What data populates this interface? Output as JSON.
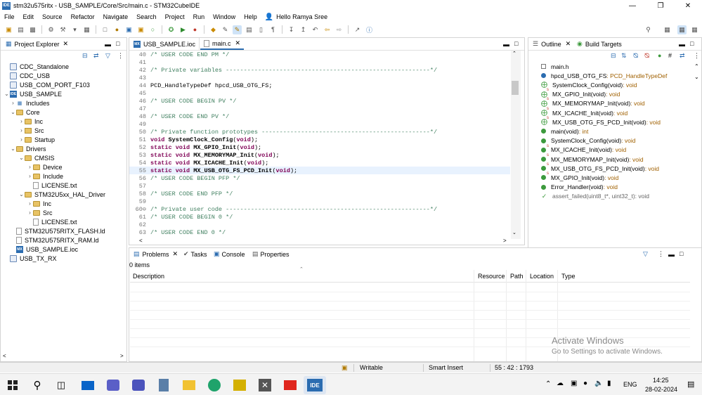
{
  "window": {
    "title": "stm32u575ritx - USB_SAMPLE/Core/Src/main.c - STM32CubeIDE",
    "app_icon": "IDE",
    "controls": [
      "minimize",
      "maximize",
      "close"
    ]
  },
  "menubar": {
    "items": [
      "File",
      "Edit",
      "Source",
      "Refactor",
      "Navigate",
      "Search",
      "Project",
      "Run",
      "Window",
      "Help"
    ],
    "user": "Hello Ramya Sree"
  },
  "project_explorer": {
    "title": "Project Explorer",
    "items": [
      {
        "label": "CDC_Standalone",
        "icon": "project-icon"
      },
      {
        "label": "CDC_USB",
        "icon": "project-icon"
      },
      {
        "label": "USB_COM_PORT_F103",
        "icon": "project-icon"
      },
      {
        "label": "USB_SAMPLE",
        "icon": "ide-project-icon"
      },
      {
        "label": "Includes",
        "icon": "includes-icon"
      },
      {
        "label": "Core",
        "icon": "folder-icon"
      },
      {
        "label": "Inc",
        "icon": "folder-icon"
      },
      {
        "label": "Src",
        "icon": "source-folder-icon"
      },
      {
        "label": "Startup",
        "icon": "folder-icon"
      },
      {
        "label": "Drivers",
        "icon": "folder-icon"
      },
      {
        "label": "CMSIS",
        "icon": "folder-icon"
      },
      {
        "label": "Device",
        "icon": "folder-icon"
      },
      {
        "label": "Include",
        "icon": "folder-icon"
      },
      {
        "label": "LICENSE.txt",
        "icon": "file-icon"
      },
      {
        "label": "STM32U5xx_HAL_Driver",
        "icon": "folder-icon"
      },
      {
        "label": "Inc",
        "icon": "folder-icon"
      },
      {
        "label": "Src",
        "icon": "folder-icon"
      },
      {
        "label": "LICENSE.txt",
        "icon": "file-icon"
      },
      {
        "label": "STM32U575RITX_FLASH.ld",
        "icon": "linker-file-icon"
      },
      {
        "label": "STM32U575RITX_RAM.ld",
        "icon": "linker-file-icon"
      },
      {
        "label": "USB_SAMPLE.ioc",
        "icon": "ioc-file-icon"
      },
      {
        "label": "USB_TX_RX",
        "icon": "project-icon"
      }
    ]
  },
  "editor": {
    "tabs": [
      {
        "label": "USB_SAMPLE.ioc",
        "active": false
      },
      {
        "label": "main.c",
        "active": true
      }
    ],
    "lines": [
      {
        "n": "40",
        "text": "/* USER CODE END PM */",
        "kind": "cmt"
      },
      {
        "n": "41",
        "text": "",
        "kind": "plain"
      },
      {
        "n": "42",
        "text": "/* Private variables ---------------------------------------------------------*/",
        "kind": "cmt"
      },
      {
        "n": "43",
        "text": "",
        "kind": "plain"
      },
      {
        "n": "44",
        "text": "PCD_HandleTypeDef hpcd_USB_OTG_FS;",
        "kind": "plain"
      },
      {
        "n": "45",
        "text": "",
        "kind": "plain"
      },
      {
        "n": "46",
        "text": "/* USER CODE BEGIN PV */",
        "kind": "cmt"
      },
      {
        "n": "47",
        "text": "",
        "kind": "plain"
      },
      {
        "n": "48",
        "text": "/* USER CODE END PV */",
        "kind": "cmt"
      },
      {
        "n": "49",
        "text": "",
        "kind": "plain"
      },
      {
        "n": "50",
        "text": "/* Private function prototypes -----------------------------------------------*/",
        "kind": "cmt"
      },
      {
        "n": "51",
        "kw": "void ",
        "fn": "SystemClock_Config",
        "rest": "(",
        "kw2": "void",
        "end": ");",
        "kind": "proto"
      },
      {
        "n": "52",
        "kw": "static void ",
        "fn": "MX_GPIO_Init",
        "rest": "(",
        "kw2": "void",
        "end": ");",
        "kind": "proto"
      },
      {
        "n": "53",
        "kw": "static void ",
        "fn": "MX_MEMORYMAP_Init",
        "rest": "(",
        "kw2": "void",
        "end": ");",
        "kind": "proto"
      },
      {
        "n": "54",
        "kw": "static void ",
        "fn": "MX_ICACHE_Init",
        "rest": "(",
        "kw2": "void",
        "end": ");",
        "kind": "proto"
      },
      {
        "n": "55",
        "kw": "static void ",
        "fn": "MX_USB_OTG_FS_PCD_Init",
        "rest": "(",
        "kw2": "void",
        "end": ");",
        "kind": "proto"
      },
      {
        "n": "56",
        "text": "/* USER CODE BEGIN PFP */",
        "kind": "cmt"
      },
      {
        "n": "57",
        "text": "",
        "kind": "plain"
      },
      {
        "n": "58",
        "text": "/* USER CODE END PFP */",
        "kind": "cmt"
      },
      {
        "n": "59",
        "text": "",
        "kind": "plain"
      },
      {
        "n": "60⊖",
        "text": "/* Private user code ---------------------------------------------------------*/",
        "kind": "cmt"
      },
      {
        "n": "61",
        "text": "/* USER CODE BEGIN 0 */",
        "kind": "cmt"
      },
      {
        "n": "62",
        "text": "",
        "kind": "plain"
      },
      {
        "n": "63",
        "text": "/* USER CODE END 0 */",
        "kind": "cmt"
      }
    ],
    "highlighted_line": "55"
  },
  "outline": {
    "tabs": [
      "Outline",
      "Build Targets"
    ],
    "items": [
      {
        "name": "main.h",
        "type": "",
        "icon": "include-icon"
      },
      {
        "name": "hpcd_USB_OTG_FS",
        "type": " : PCD_HandleTypeDef",
        "icon": "variable-icon"
      },
      {
        "name": "SystemClock_Config(void)",
        "type": " : void",
        "icon": "function-decl-icon"
      },
      {
        "name": "MX_GPIO_Init(void)",
        "type": " : void",
        "icon": "static-function-decl-icon"
      },
      {
        "name": "MX_MEMORYMAP_Init(void)",
        "type": " : void",
        "icon": "static-function-decl-icon"
      },
      {
        "name": "MX_ICACHE_Init(void)",
        "type": " : void",
        "icon": "static-function-decl-icon"
      },
      {
        "name": "MX_USB_OTG_FS_PCD_Init(void)",
        "type": " : void",
        "icon": "static-function-decl-icon"
      },
      {
        "name": "main(void)",
        "type": " : int",
        "icon": "function-icon"
      },
      {
        "name": "SystemClock_Config(void)",
        "type": " : void",
        "icon": "function-icon"
      },
      {
        "name": "MX_ICACHE_Init(void)",
        "type": " : void",
        "icon": "static-function-icon"
      },
      {
        "name": "MX_MEMORYMAP_Init(void)",
        "type": " : void",
        "icon": "static-function-icon"
      },
      {
        "name": "MX_USB_OTG_FS_PCD_Init(void)",
        "type": " : void",
        "icon": "static-function-icon"
      },
      {
        "name": "MX_GPIO_Init(void)",
        "type": " : void",
        "icon": "static-function-icon"
      },
      {
        "name": "Error_Handler(void)",
        "type": " : void",
        "icon": "function-icon"
      },
      {
        "name": "assert_failed(uint8_t*, uint32_t)",
        "type": " : void",
        "icon": "inactive-function-icon"
      }
    ]
  },
  "bottom_panel": {
    "tabs": [
      "Problems",
      "Tasks",
      "Console",
      "Properties"
    ],
    "count": "0 items",
    "columns": [
      "Description",
      "Resource",
      "Path",
      "Location",
      "Type"
    ]
  },
  "statusbar": {
    "mode": "Writable",
    "insert": "Smart Insert",
    "position": "55 : 42 : 1793"
  },
  "watermark": {
    "line1": "Activate Windows",
    "line2": "Go to Settings to activate Windows."
  },
  "taskbar": {
    "language": "ENG",
    "time": "14:25",
    "date": "28-02-2024"
  },
  "colors": {
    "comment": "#3f7f5f",
    "keyword": "#7f0055",
    "accent": "#2b6cb0",
    "current_line": "#e8f2fe"
  }
}
